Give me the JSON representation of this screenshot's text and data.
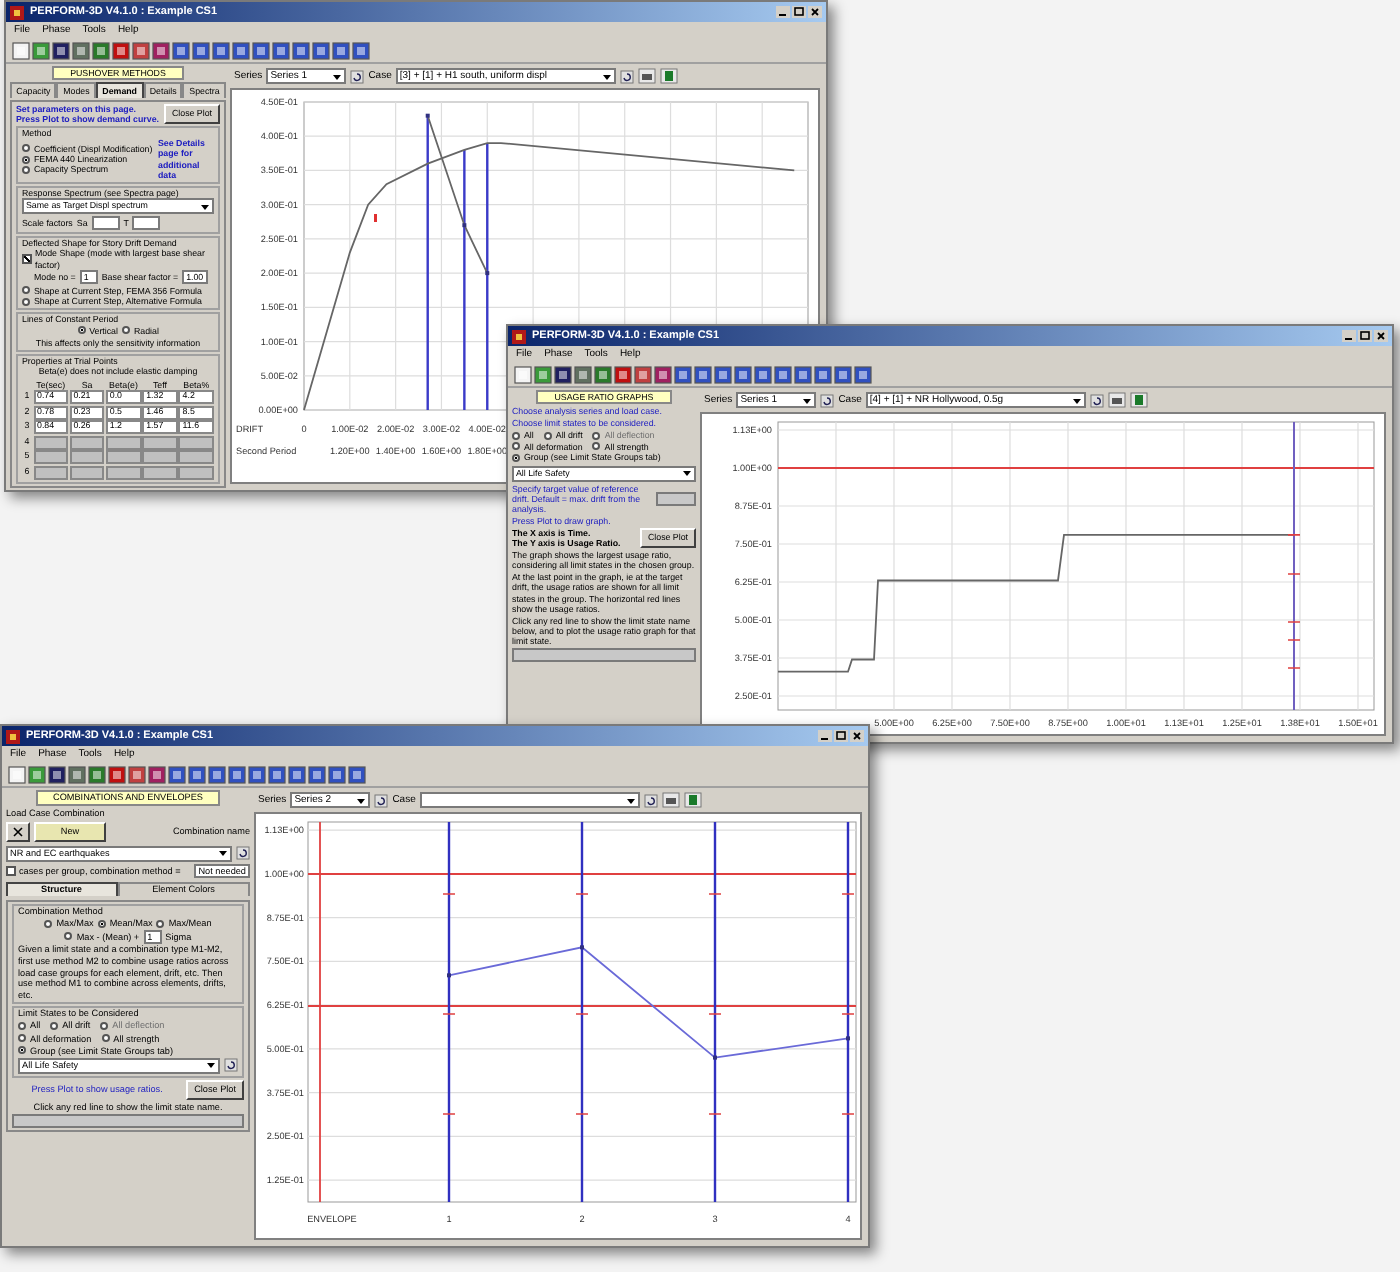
{
  "windows": [
    {
      "kind": "pushover",
      "title": "PERFORM-3D V4.1.0 : Example CS1",
      "menu": [
        "File",
        "Phase",
        "Tools",
        "Help"
      ],
      "series_label": "Series",
      "series": "Series 1",
      "case_label": "Case",
      "case": "[3] + [1] + H1 south, uniform displ",
      "panel": {
        "title": "PUSHOVER METHODS",
        "tabs": [
          {
            "label": "Capacity",
            "selected": false
          },
          {
            "label": "Modes",
            "selected": false
          },
          {
            "label": "Demand",
            "selected": true
          },
          {
            "label": "Details",
            "selected": false
          },
          {
            "label": "Spectra",
            "selected": false
          }
        ],
        "instructions": "Set parameters on this page. Press Plot to show demand curve.",
        "close_button": "Close Plot",
        "method_label": "Method",
        "methods": [
          {
            "label": "Coefficient (Displ Modification)",
            "selected": false
          },
          {
            "label": "FEMA 440 Linearization",
            "selected": true
          },
          {
            "label": "Capacity Spectrum",
            "selected": false
          }
        ],
        "method_note": "See Details page for additional data",
        "spectrum_label": "Response Spectrum (see Spectra page)",
        "spectrum_value": "Same as Target Displ spectrum",
        "scale_label": "Scale factors",
        "sa_label": "Sa",
        "t_label": "T",
        "shape_label": "Deflected Shape for Story Drift Demand",
        "mode_shape": {
          "label": "Mode Shape (mode with largest base shear factor)",
          "checked": true
        },
        "mode_label": "Mode no =",
        "mode_value": "1",
        "shear_label": "Base shear factor =",
        "shear_value": "1.00",
        "shapes": [
          {
            "label": "Shape at Current Step, FEMA 356 Formula",
            "selected": false
          },
          {
            "label": "Shape at Current Step, Alternative Formula",
            "selected": false
          }
        ],
        "period_label": "Lines of Constant Period",
        "periods": [
          {
            "label": "Vertical",
            "selected": true
          },
          {
            "label": "Radial",
            "selected": false
          }
        ],
        "period_note": "This affects only the sensitivity information",
        "trial_label": "Properties at Trial Points",
        "trial_note": "Beta(e) does not include elastic damping",
        "trial_columns": [
          "Te(sec)",
          "Sa",
          "Beta(e)",
          "Teff",
          "Beta%"
        ],
        "trial_rows": [
          {
            "index": "1",
            "cells": [
              "0.74",
              "0.21",
              "0.0",
              "1.32",
              "4.2"
            ]
          },
          {
            "index": "2",
            "cells": [
              "0.78",
              "0.23",
              "0.5",
              "1.46",
              "8.5"
            ]
          },
          {
            "index": "3",
            "cells": [
              "0.84",
              "0.26",
              "1.2",
              "1.57",
              "11.6"
            ]
          },
          {
            "index": "4"
          },
          {
            "index": "5"
          },
          {
            "index": "6"
          }
        ]
      },
      "chart_data": {
        "type": "line",
        "xlabel": "DRIFT",
        "x": [
          0,
          0.01,
          0.014,
          0.018,
          0.027,
          0.035,
          0.04,
          0.043,
          0.107
        ],
        "series": [
          {
            "color": "#666666",
            "marker": false,
            "values": [
              0,
              0.23,
              0.3,
              0.33,
              0.36,
              0.38,
              0.39,
              0.39,
              0.35
            ]
          },
          {
            "color": "#666666",
            "marker": true,
            "values": [
              null,
              null,
              null,
              null,
              0.43,
              0.27,
              0.2,
              null,
              null
            ]
          }
        ],
        "xlim": [
          0,
          0.11
        ],
        "ylim": [
          0,
          0.45
        ],
        "grid": true,
        "ref_lines": [
          {
            "axis": "x",
            "value": 0.027,
            "color": "#3a3ac8"
          },
          {
            "axis": "x",
            "value": 0.035,
            "color": "#3a3ac8"
          },
          {
            "axis": "x",
            "value": 0.04,
            "color": "#3a3ac8"
          }
        ],
        "xticks": [
          {
            "value": 0,
            "label": "0"
          },
          {
            "value": 0.01,
            "label": "1.00E-02"
          },
          {
            "value": 0.02,
            "label": "2.00E-02"
          },
          {
            "value": 0.03,
            "label": "3.00E-02"
          },
          {
            "value": 0.04,
            "label": "4.00E-02"
          }
        ],
        "yticks": [
          {
            "value": 0.45,
            "label": "4.50E-01"
          },
          {
            "value": 0.4,
            "label": "4.00E-01"
          },
          {
            "value": 0.35,
            "label": "3.50E-01"
          },
          {
            "value": 0.3,
            "label": "3.00E-01"
          },
          {
            "value": 0.25,
            "label": "2.50E-01"
          },
          {
            "value": 0.2,
            "label": "2.00E-01"
          },
          {
            "value": 0.15,
            "label": "1.50E-01"
          },
          {
            "value": 0.1,
            "label": "1.00E-01"
          },
          {
            "value": 0.05,
            "label": "5.00E-02"
          },
          {
            "value": 0,
            "label": "0.00E+00"
          }
        ]
      },
      "secondary_axis": {
        "label": "Second Period",
        "ticks": [
          "1.20E+00",
          "1.40E+00",
          "1.60E+00",
          "1.80E+00"
        ]
      }
    },
    {
      "kind": "usage",
      "title": "PERFORM-3D V4.1.0 : Example CS1",
      "menu": [
        "File",
        "Phase",
        "Tools",
        "Help"
      ],
      "series_label": "Series",
      "series": "Series 1",
      "case_label": "Case",
      "case": "[4] + [1] + NR Hollywood, 0.5g",
      "panel": {
        "title": "USAGE RATIO GRAPHS",
        "intro": [
          "Choose analysis series and load case.",
          "Choose limit states to be considered."
        ],
        "limits": [
          {
            "label": "All",
            "selected": false,
            "disabled": false
          },
          {
            "label": "All drift",
            "selected": false,
            "disabled": false
          },
          {
            "label": "All deflection",
            "selected": false,
            "disabled": true
          },
          {
            "label": "All deformation",
            "selected": false,
            "disabled": false
          },
          {
            "label": "All strength",
            "selected": false,
            "disabled": false
          },
          {
            "label": "Group (see Limit State Groups tab)",
            "selected": true,
            "disabled": false
          }
        ],
        "group_value": "All Life Safety",
        "target_note": "Specify target value of reference drift. Default = max. drift from the analysis.",
        "plot_note": "Press Plot to draw graph.",
        "axis_notes": [
          "The X axis is Time.",
          "The Y axis is Usage Ratio."
        ],
        "close_button": "Close Plot",
        "description": [
          "The graph shows the largest usage ratio, considering all limit states in the chosen group.",
          "At the last point in the graph, ie at the target drift, the usage ratios are shown for all limit states in the group. The horizontal red lines show the usage ratios.",
          "Click any red line to show the limit state name below, and to plot the usage ratio graph for that limit state."
        ]
      },
      "chart": {
        "y_ticks": [
          "1.13E+00",
          "1.00E+00",
          "8.75E-01",
          "7.50E-01",
          "6.25E-01",
          "5.00E-01",
          "3.75E-01",
          "2.50E-01"
        ],
        "x_ticks": [
          "5.00E+00",
          "6.25E+00",
          "7.50E+00",
          "8.75E+00",
          "1.00E+01",
          "1.13E+01",
          "1.25E+01",
          "1.38E+01",
          "1.50E+01"
        ]
      }
    },
    {
      "kind": "combination",
      "title": "PERFORM-3D V4.1.0 : Example CS1",
      "menu": [
        "File",
        "Phase",
        "Tools",
        "Help"
      ],
      "series_label": "Series",
      "series": "Series 2",
      "case_label": "Case",
      "panel": {
        "title": "COMBINATIONS AND ENVELOPES",
        "load_label": "Load Case Combination",
        "new_button": "New",
        "name_label": "Combination name",
        "combination_value": "NR and EC earthquakes",
        "cases_check": {
          "label": "cases per group, combination method =",
          "checked": false
        },
        "cases_value": "Not needed",
        "tabs": [
          {
            "label": "Structure",
            "selected": true
          },
          {
            "label": "Element Colors",
            "selected": false
          }
        ],
        "method_label": "Combination Method",
        "methods": [
          {
            "label": "Max/Max",
            "selected": false
          },
          {
            "label": "Mean/Max",
            "selected": true
          },
          {
            "label": "Max/Mean",
            "selected": false
          }
        ],
        "sigma": {
          "label": "Max - (Mean) +",
          "selected": false,
          "value": "1",
          "unit": "Sigma"
        },
        "method_note": "Given a limit state and a combination type M1-M2, first use method M2 to combine usage ratios across load case groups for each element, drift, etc. Then use method M1 to combine across elements, drifts, etc.",
        "limit_label": "Limit States to be Considered",
        "limits": [
          {
            "label": "All",
            "selected": false,
            "disabled": false
          },
          {
            "label": "All drift",
            "selected": false,
            "disabled": false
          },
          {
            "label": "All deflection",
            "selected": false,
            "disabled": true
          },
          {
            "label": "All deformation",
            "selected": false,
            "disabled": false
          },
          {
            "label": "All strength",
            "selected": false,
            "disabled": false
          },
          {
            "label": "Group (see Limit State Groups tab)",
            "selected": true,
            "disabled": false
          }
        ],
        "group_value": "All Life Safety",
        "plot_note": "Press Plot to show usage ratios.",
        "close_button": "Close Plot",
        "click_note": "Click any red line to show the limit state name."
      },
      "chart_data": {
        "type": "line",
        "categories": [
          "ENVELOPE",
          "1",
          "2",
          "3",
          "4"
        ],
        "series": [
          {
            "color": "#6a6ad8",
            "marker": true,
            "values": [
              null,
              0.71,
              0.79,
              0.475,
              0.53
            ]
          }
        ],
        "ylim": [
          0.0625,
          1.148
        ],
        "grid": true,
        "yticks": [
          {
            "value": 1.125,
            "label": "1.13E+00"
          },
          {
            "value": 1,
            "label": "1.00E+00"
          },
          {
            "value": 0.875,
            "label": "8.75E-01"
          },
          {
            "value": 0.75,
            "label": "7.50E-01"
          },
          {
            "value": 0.625,
            "label": "6.25E-01"
          },
          {
            "value": 0.5,
            "label": "5.00E-01"
          },
          {
            "value": 0.375,
            "label": "3.75E-01"
          },
          {
            "value": 0.25,
            "label": "2.50E-01"
          },
          {
            "value": 0.125,
            "label": "1.25E-01"
          }
        ]
      }
    }
  ]
}
